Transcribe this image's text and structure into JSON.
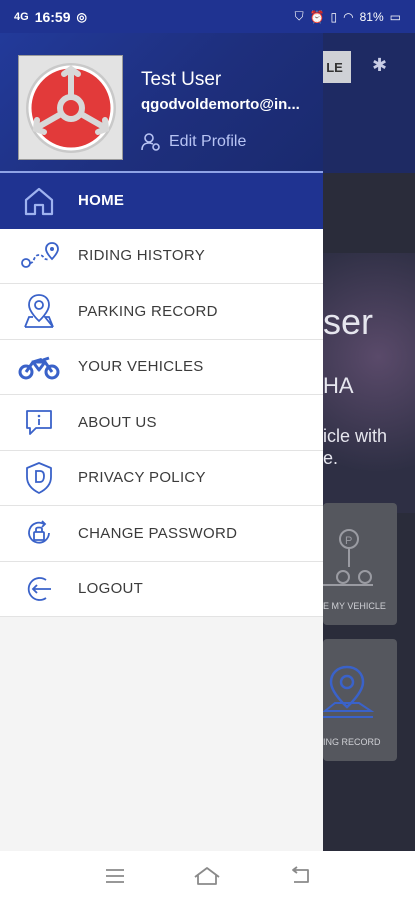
{
  "status_bar": {
    "time": "16:59",
    "battery": "81%"
  },
  "background": {
    "partial_button": "LE",
    "hero_title": "ser",
    "hero_subtitle": "HA",
    "hero_desc_line1": "icle with",
    "hero_desc_line2": "e.",
    "card1_label": "E MY VEHICLE",
    "card2_label": "ING RECORD"
  },
  "profile": {
    "name": "Test User",
    "email": "qgodvoldemorto@in...",
    "edit_label": "Edit Profile"
  },
  "menu": [
    {
      "label": "HOME",
      "icon": "home-icon",
      "active": true
    },
    {
      "label": "RIDING HISTORY",
      "icon": "route-icon",
      "active": false
    },
    {
      "label": "PARKING RECORD",
      "icon": "map-pin-icon",
      "active": false
    },
    {
      "label": "YOUR VEHICLES",
      "icon": "motorcycle-icon",
      "active": false
    },
    {
      "label": "ABOUT US",
      "icon": "info-icon",
      "active": false
    },
    {
      "label": "PRIVACY POLICY",
      "icon": "shield-icon",
      "active": false
    },
    {
      "label": "CHANGE PASSWORD",
      "icon": "lock-reset-icon",
      "active": false
    },
    {
      "label": "LOGOUT",
      "icon": "logout-icon",
      "active": false
    }
  ],
  "colors": {
    "brand_blue": "#1f3391",
    "icon_blue": "#3a62c9",
    "accent_blue": "#b8c4f4"
  }
}
